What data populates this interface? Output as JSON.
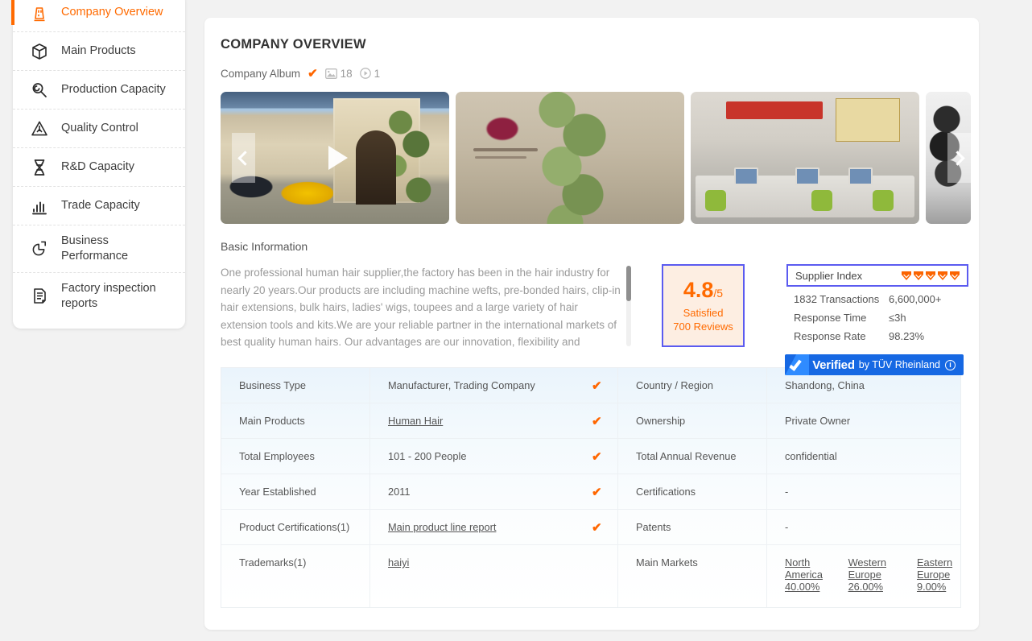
{
  "sidebar": {
    "items": [
      {
        "label": "Company Overview",
        "icon": "factory-icon",
        "active": true
      },
      {
        "label": "Main Products",
        "icon": "cube-icon",
        "active": false
      },
      {
        "label": "Production Capacity",
        "icon": "wrench-magnifier-icon",
        "active": false
      },
      {
        "label": "Quality Control",
        "icon": "triangle-alert-icon",
        "active": false
      },
      {
        "label": "R&D Capacity",
        "icon": "dna-icon",
        "active": false
      },
      {
        "label": "Trade Capacity",
        "icon": "bar-chart-icon",
        "active": false
      },
      {
        "label": "Business Performance",
        "icon": "pie-chart-icon",
        "active": false
      },
      {
        "label": "Factory inspection reports",
        "icon": "document-icon",
        "active": false
      }
    ]
  },
  "main": {
    "title": "COMPANY OVERVIEW",
    "album": {
      "label": "Company Album",
      "verified_tick": "✔",
      "photo_count": "18",
      "video_count": "1"
    },
    "gallery": {
      "prev_label": "‹",
      "next_label": "›",
      "slides": [
        {
          "name": "company-villa-entrance-video",
          "is_video": true
        },
        {
          "name": "company-building-entrance",
          "is_video": false
        },
        {
          "name": "office-workers",
          "is_video": false
        },
        {
          "name": "outdoor-tree",
          "is_video": false
        }
      ]
    },
    "basic_information": {
      "heading": "Basic Information",
      "description": "One professional human hair supplier,the factory has been in the hair industry for nearly 20 years.Our products are including machine wefts, pre-bonded hairs, clip-in hair extensions, bulk hairs, ladies' wigs, toupees and a large variety of hair extension tools and kits.We are your reliable partner in the international markets of best quality human hairs. Our advantages are our innovation, flexibility and reliability which have"
    },
    "rating": {
      "score": "4.8",
      "denominator": "/5",
      "satisfied_label": "Satisfied",
      "reviews_label": "700 Reviews"
    },
    "supplier_index": {
      "title": "Supplier Index",
      "diamonds": 5,
      "rows": [
        {
          "key": "1832 Transactions",
          "value": "6,600,000+"
        },
        {
          "key": "Response Time",
          "value": "≤3h"
        },
        {
          "key": "Response Rate",
          "value": "98.23%"
        }
      ]
    },
    "verified_badge": {
      "check": "✔",
      "bold_text": "Verified",
      "normal_text": "by TÜV Rheinland",
      "info": "i"
    },
    "info_table": {
      "rows": [
        {
          "left_key": "Business Type",
          "left_value": "Manufacturer, Trading Company",
          "left_link": false,
          "left_check": true,
          "right_key": "Country / Region",
          "right_value": "Shandong, China",
          "right_link": false,
          "right_check": true
        },
        {
          "left_key": "Main Products",
          "left_value": "Human Hair",
          "left_link": true,
          "left_check": true,
          "right_key": "Ownership",
          "right_value": "Private Owner",
          "right_link": false,
          "right_check": true
        },
        {
          "left_key": "Total Employees",
          "left_value": "101 - 200 People",
          "left_link": false,
          "left_check": true,
          "right_key": "Total Annual Revenue",
          "right_value": "confidential",
          "right_link": false,
          "right_check": true
        },
        {
          "left_key": "Year Established",
          "left_value": "2011",
          "left_link": false,
          "left_check": true,
          "right_key": "Certifications",
          "right_value": "-",
          "right_link": false,
          "right_check": false
        },
        {
          "left_key": "Product Certifications(1)",
          "left_value": "Main product line report",
          "left_link": true,
          "left_check": true,
          "right_key": "Patents",
          "right_value": "-",
          "right_link": false,
          "right_check": false
        },
        {
          "left_key": "Trademarks(1)",
          "left_value": "haiyi",
          "left_link": true,
          "left_check": false,
          "right_key": "Main Markets",
          "right_values": [
            "North America 40.00%",
            "Western Europe 26.00%",
            "Eastern Europe 9.00%"
          ],
          "right_link": true,
          "right_check": true
        }
      ]
    }
  },
  "colors": {
    "accent_orange": "#ff6a00",
    "badge_blue": "#1668e3",
    "highlight_border": "#5b5bf0",
    "rating_bg": "#fdeee2",
    "page_bg": "#f2f2f2"
  }
}
